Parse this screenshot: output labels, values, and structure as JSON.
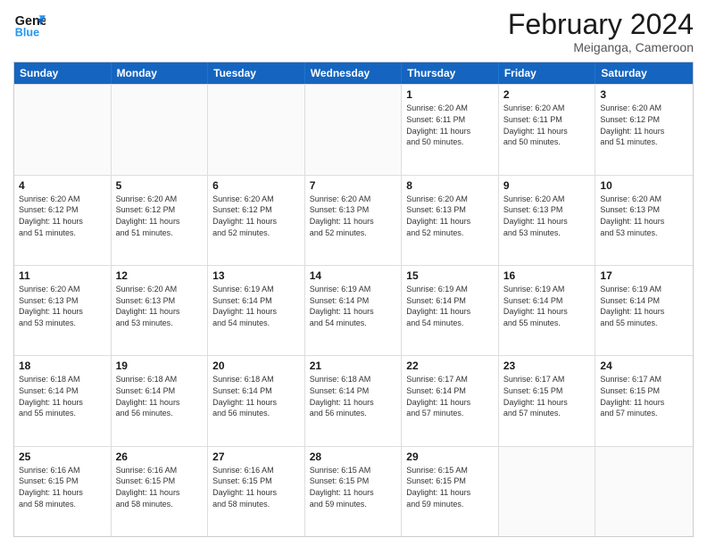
{
  "header": {
    "logo_line1": "General",
    "logo_line2": "Blue",
    "title": "February 2024",
    "subtitle": "Meiganga, Cameroon"
  },
  "days": [
    "Sunday",
    "Monday",
    "Tuesday",
    "Wednesday",
    "Thursday",
    "Friday",
    "Saturday"
  ],
  "weeks": [
    [
      {
        "day": "",
        "info": ""
      },
      {
        "day": "",
        "info": ""
      },
      {
        "day": "",
        "info": ""
      },
      {
        "day": "",
        "info": ""
      },
      {
        "day": "1",
        "info": "Sunrise: 6:20 AM\nSunset: 6:11 PM\nDaylight: 11 hours\nand 50 minutes."
      },
      {
        "day": "2",
        "info": "Sunrise: 6:20 AM\nSunset: 6:11 PM\nDaylight: 11 hours\nand 50 minutes."
      },
      {
        "day": "3",
        "info": "Sunrise: 6:20 AM\nSunset: 6:12 PM\nDaylight: 11 hours\nand 51 minutes."
      }
    ],
    [
      {
        "day": "4",
        "info": "Sunrise: 6:20 AM\nSunset: 6:12 PM\nDaylight: 11 hours\nand 51 minutes."
      },
      {
        "day": "5",
        "info": "Sunrise: 6:20 AM\nSunset: 6:12 PM\nDaylight: 11 hours\nand 51 minutes."
      },
      {
        "day": "6",
        "info": "Sunrise: 6:20 AM\nSunset: 6:12 PM\nDaylight: 11 hours\nand 52 minutes."
      },
      {
        "day": "7",
        "info": "Sunrise: 6:20 AM\nSunset: 6:13 PM\nDaylight: 11 hours\nand 52 minutes."
      },
      {
        "day": "8",
        "info": "Sunrise: 6:20 AM\nSunset: 6:13 PM\nDaylight: 11 hours\nand 52 minutes."
      },
      {
        "day": "9",
        "info": "Sunrise: 6:20 AM\nSunset: 6:13 PM\nDaylight: 11 hours\nand 53 minutes."
      },
      {
        "day": "10",
        "info": "Sunrise: 6:20 AM\nSunset: 6:13 PM\nDaylight: 11 hours\nand 53 minutes."
      }
    ],
    [
      {
        "day": "11",
        "info": "Sunrise: 6:20 AM\nSunset: 6:13 PM\nDaylight: 11 hours\nand 53 minutes."
      },
      {
        "day": "12",
        "info": "Sunrise: 6:20 AM\nSunset: 6:13 PM\nDaylight: 11 hours\nand 53 minutes."
      },
      {
        "day": "13",
        "info": "Sunrise: 6:19 AM\nSunset: 6:14 PM\nDaylight: 11 hours\nand 54 minutes."
      },
      {
        "day": "14",
        "info": "Sunrise: 6:19 AM\nSunset: 6:14 PM\nDaylight: 11 hours\nand 54 minutes."
      },
      {
        "day": "15",
        "info": "Sunrise: 6:19 AM\nSunset: 6:14 PM\nDaylight: 11 hours\nand 54 minutes."
      },
      {
        "day": "16",
        "info": "Sunrise: 6:19 AM\nSunset: 6:14 PM\nDaylight: 11 hours\nand 55 minutes."
      },
      {
        "day": "17",
        "info": "Sunrise: 6:19 AM\nSunset: 6:14 PM\nDaylight: 11 hours\nand 55 minutes."
      }
    ],
    [
      {
        "day": "18",
        "info": "Sunrise: 6:18 AM\nSunset: 6:14 PM\nDaylight: 11 hours\nand 55 minutes."
      },
      {
        "day": "19",
        "info": "Sunrise: 6:18 AM\nSunset: 6:14 PM\nDaylight: 11 hours\nand 56 minutes."
      },
      {
        "day": "20",
        "info": "Sunrise: 6:18 AM\nSunset: 6:14 PM\nDaylight: 11 hours\nand 56 minutes."
      },
      {
        "day": "21",
        "info": "Sunrise: 6:18 AM\nSunset: 6:14 PM\nDaylight: 11 hours\nand 56 minutes."
      },
      {
        "day": "22",
        "info": "Sunrise: 6:17 AM\nSunset: 6:14 PM\nDaylight: 11 hours\nand 57 minutes."
      },
      {
        "day": "23",
        "info": "Sunrise: 6:17 AM\nSunset: 6:15 PM\nDaylight: 11 hours\nand 57 minutes."
      },
      {
        "day": "24",
        "info": "Sunrise: 6:17 AM\nSunset: 6:15 PM\nDaylight: 11 hours\nand 57 minutes."
      }
    ],
    [
      {
        "day": "25",
        "info": "Sunrise: 6:16 AM\nSunset: 6:15 PM\nDaylight: 11 hours\nand 58 minutes."
      },
      {
        "day": "26",
        "info": "Sunrise: 6:16 AM\nSunset: 6:15 PM\nDaylight: 11 hours\nand 58 minutes."
      },
      {
        "day": "27",
        "info": "Sunrise: 6:16 AM\nSunset: 6:15 PM\nDaylight: 11 hours\nand 58 minutes."
      },
      {
        "day": "28",
        "info": "Sunrise: 6:15 AM\nSunset: 6:15 PM\nDaylight: 11 hours\nand 59 minutes."
      },
      {
        "day": "29",
        "info": "Sunrise: 6:15 AM\nSunset: 6:15 PM\nDaylight: 11 hours\nand 59 minutes."
      },
      {
        "day": "",
        "info": ""
      },
      {
        "day": "",
        "info": ""
      }
    ]
  ]
}
